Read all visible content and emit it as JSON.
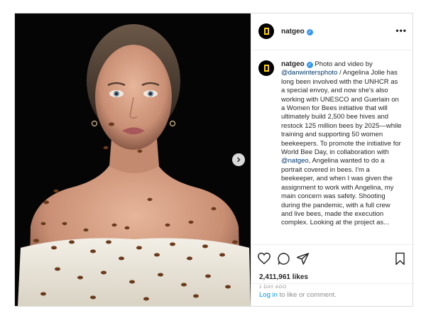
{
  "post": {
    "username": "natgeo",
    "verified_mark": "✓",
    "more_label": "•••",
    "caption": {
      "p1": "Photo and video by",
      "mention1": "@danwintersphoto",
      "p2": " / Angelina Jolie has long been involved with the UNHCR as a special envoy, and now she's also working with UNESCO and Guerlain on a Women for Bees initiative that will ultimately build 2,500 bee hives and restock 125 million bees by 2025—while training and supporting 50 women beekeepers. To promote the initiative for World Bee Day, in collaboration with ",
      "mention2": "@natgeo",
      "p3": ", Angelina wanted to do a portrait covered in bees. I'm a beekeeper, and when I was given the assignment to work with Angelina, my main concern was safety. Shooting during the pandemic, with a full crew and live bees, made the execution complex. Looking at the project as..."
    },
    "likes": "2,411,961 likes",
    "age": "1 DAY AGO",
    "login": {
      "link": "Log in",
      "text": " to like or comment."
    }
  },
  "icons": {
    "brand": "natgeo-frame-icon",
    "next": "chevron-right-icon",
    "like": "heart-icon",
    "comment": "comment-icon",
    "share": "paper-plane-icon",
    "save": "bookmark-icon"
  },
  "colors": {
    "accent_blue": "#0095f6",
    "verified": "#3897f0",
    "brand_yellow": "#ffd200"
  }
}
